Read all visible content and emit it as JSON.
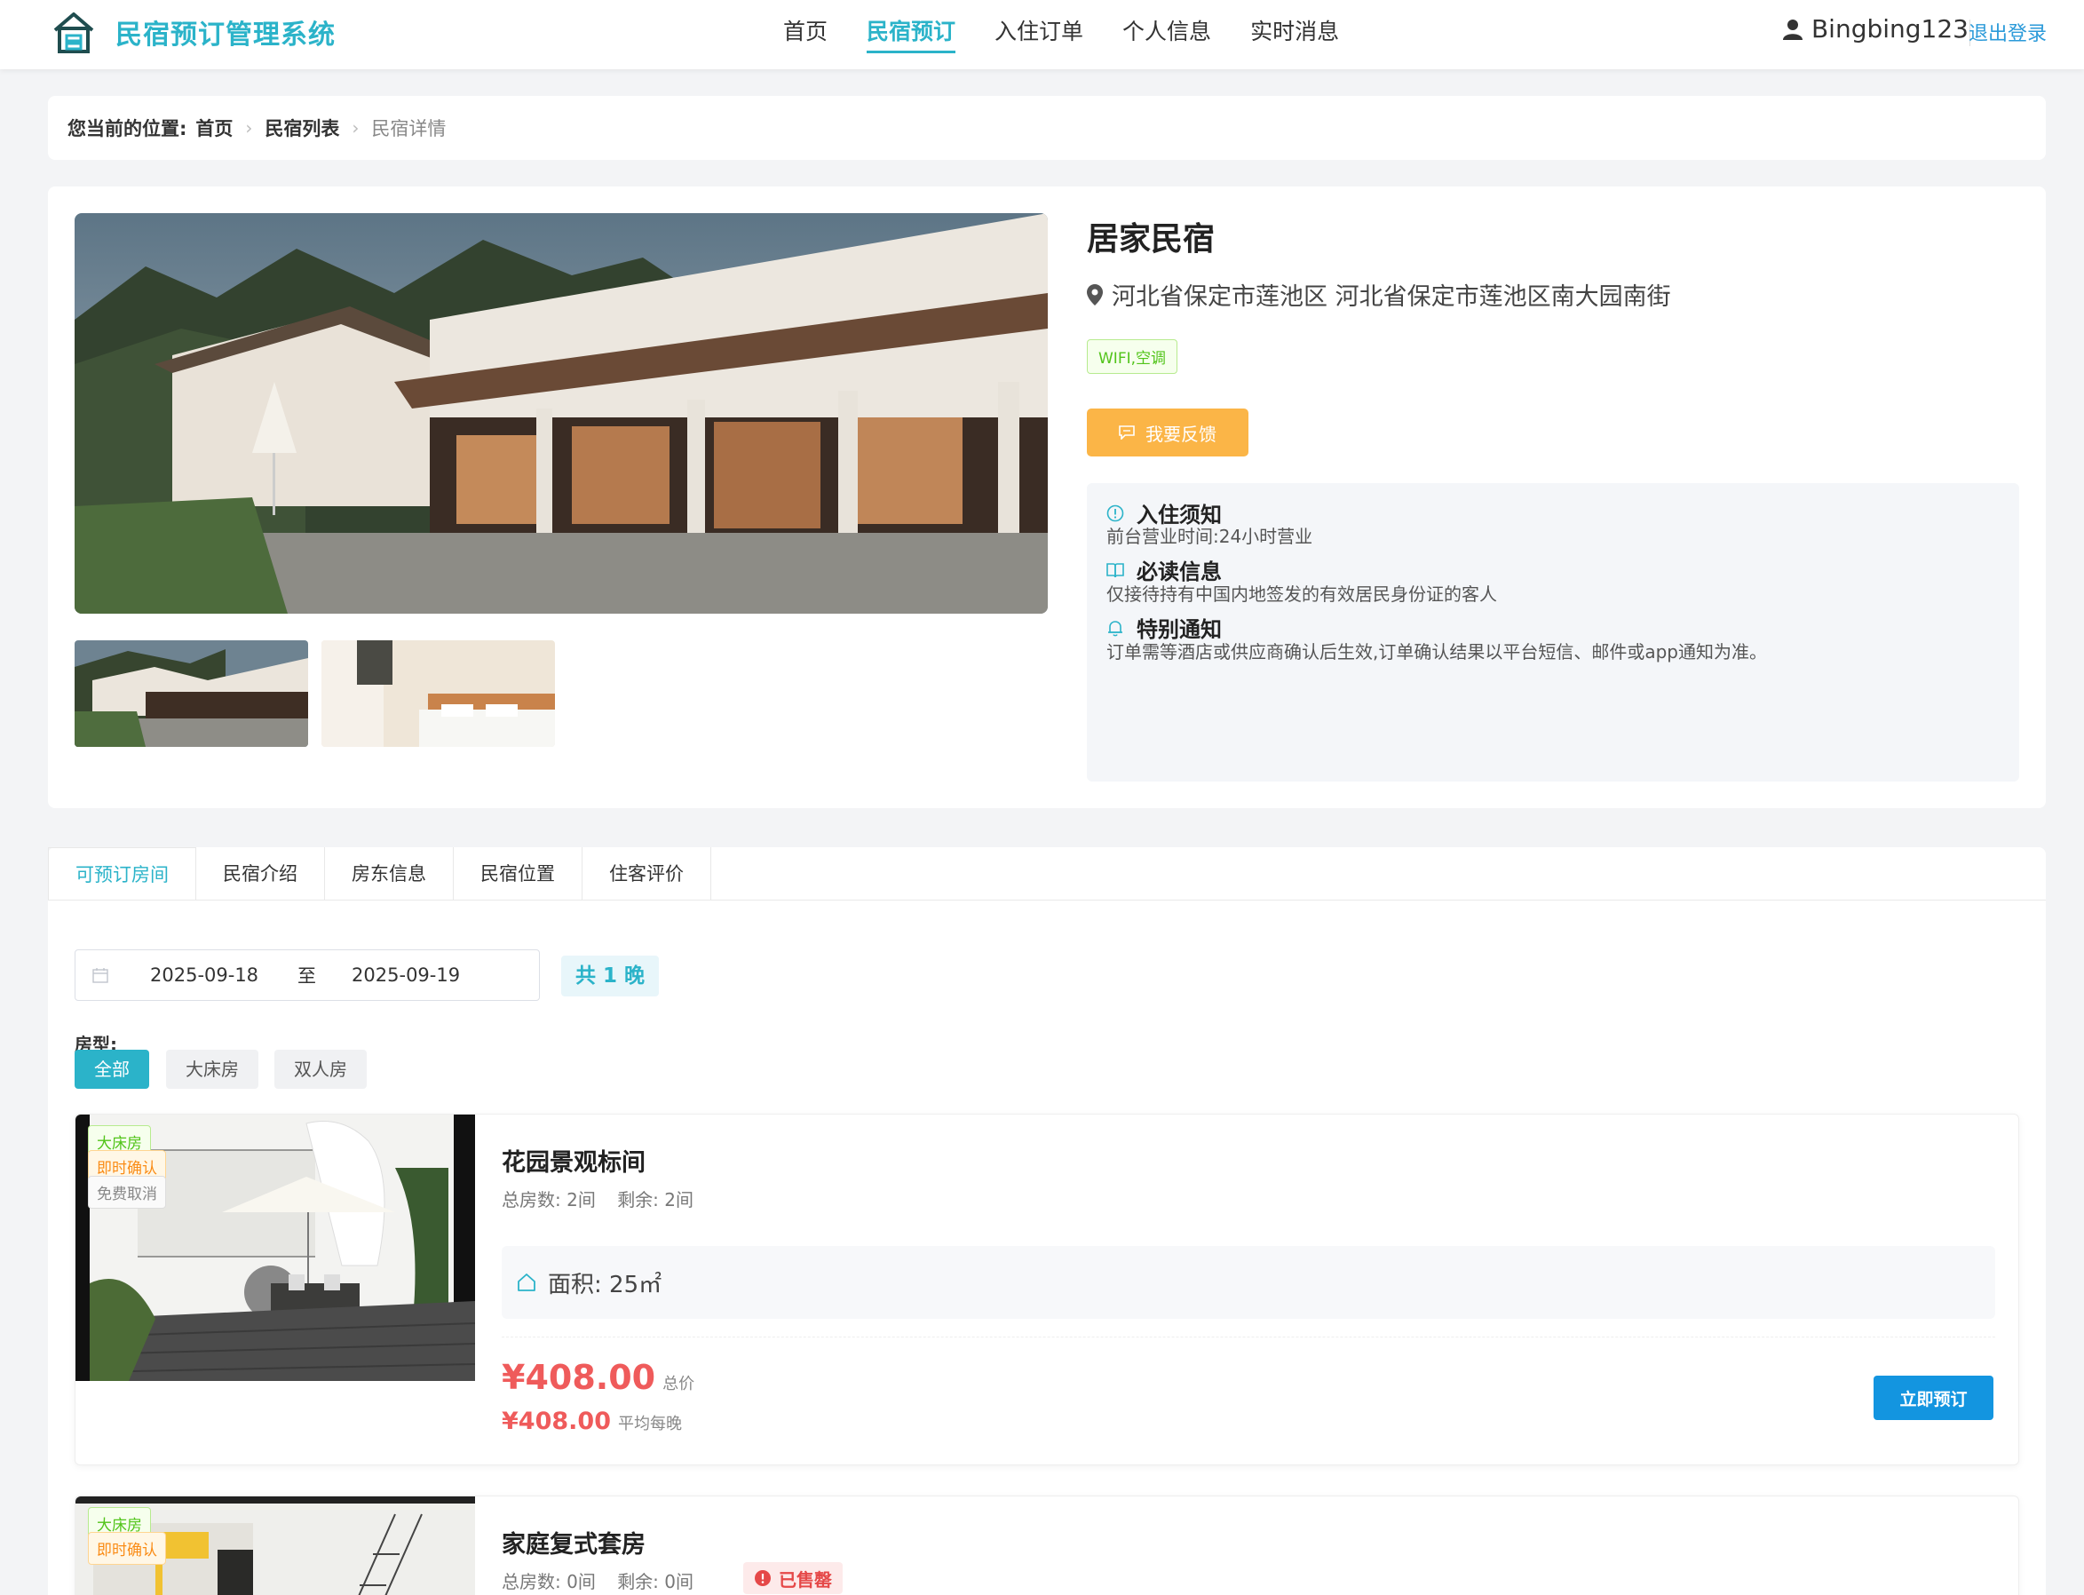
{
  "header": {
    "brand": "民宿预订管理系统",
    "nav": [
      {
        "label": "首页"
      },
      {
        "label": "民宿预订"
      },
      {
        "label": "入住订单"
      },
      {
        "label": "个人信息"
      },
      {
        "label": "实时消息"
      }
    ],
    "active_nav": "民宿预订",
    "username": "Bingbing123",
    "logout": "退出登录"
  },
  "breadcrumb": {
    "label": "您当前的位置:",
    "items": [
      "首页",
      "民宿列表",
      "民宿详情"
    ]
  },
  "homestay": {
    "name": "居家民宿",
    "address": "河北省保定市莲池区 河北省保定市莲池区南大园南街",
    "facility_tag": "WIFI,空调",
    "feedback_button": "我要反馈"
  },
  "notices": [
    {
      "icon": "info-icon",
      "title": "入住须知",
      "text": "前台营业时间:24小时营业"
    },
    {
      "icon": "book-icon",
      "title": "必读信息",
      "text": "仅接待持有中国内地签发的有效居民身份证的客人"
    },
    {
      "icon": "bell-icon",
      "title": "特别通知",
      "text": "订单需等酒店或供应商确认后生效,订单确认结果以平台短信、邮件或app通知为准。"
    }
  ],
  "tabs": [
    "可预订房间",
    "民宿介绍",
    "房东信息",
    "民宿位置",
    "住客评价"
  ],
  "active_tab": "可预订房间",
  "booking": {
    "start_date": "2025-09-18",
    "separator": "至",
    "end_date": "2025-09-19",
    "nights": "共 1 晚"
  },
  "room_type": {
    "label": "房型:",
    "options": [
      "全部",
      "大床房",
      "双人房"
    ],
    "selected": "全部"
  },
  "rooms": [
    {
      "name": "花园景观标间",
      "tags": [
        "大床房",
        "即时确认",
        "免费取消"
      ],
      "count": "总房数: 2间",
      "remaining": "剩余: 2间",
      "area": "面积: 25㎡",
      "total_price": "¥408.00",
      "total_unit": "总价",
      "avg_price": "¥408.00",
      "avg_unit": "平均每晚",
      "book_button": "立即预订"
    },
    {
      "name": "家庭复式套房",
      "tags": [
        "大床房",
        "即时确认"
      ],
      "count": "总房数: 0间",
      "remaining": "剩余: 0间",
      "status": "已售罄"
    }
  ],
  "colors": {
    "brand": "#2bb3c9",
    "price": "#ef5b5b",
    "book_button": "#1395e0",
    "feedback_button": "#fbb547"
  }
}
